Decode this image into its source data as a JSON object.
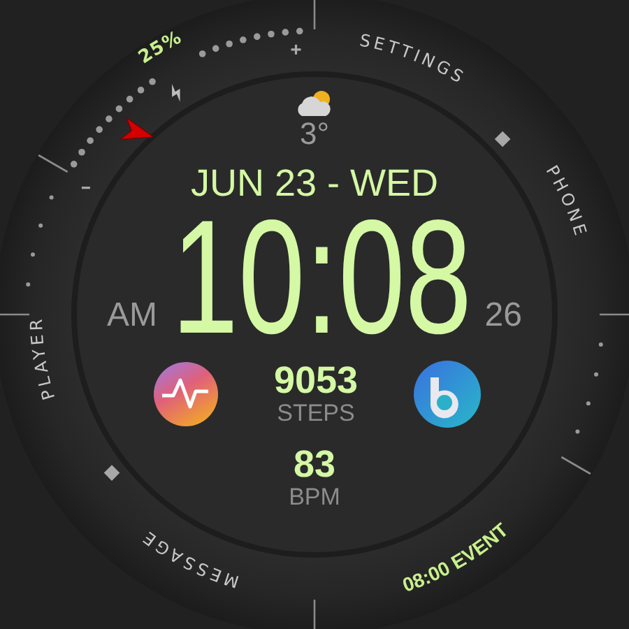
{
  "battery": {
    "percent": "25%",
    "charging": true
  },
  "weather": {
    "temperature": "3°"
  },
  "date": "JUN 23 - WED",
  "time": "10:08",
  "meridiem": "AM",
  "seconds": "26",
  "steps": {
    "value": "9053",
    "label": "STEPS"
  },
  "heart_rate": {
    "value": "83",
    "label": "BPM"
  },
  "shortcuts": [
    {
      "label": "SETTINGS"
    },
    {
      "label": "PHONE"
    },
    {
      "label": "PLAYER"
    },
    {
      "label": "MESSAGE"
    }
  ],
  "event": "08:00 EVENT"
}
